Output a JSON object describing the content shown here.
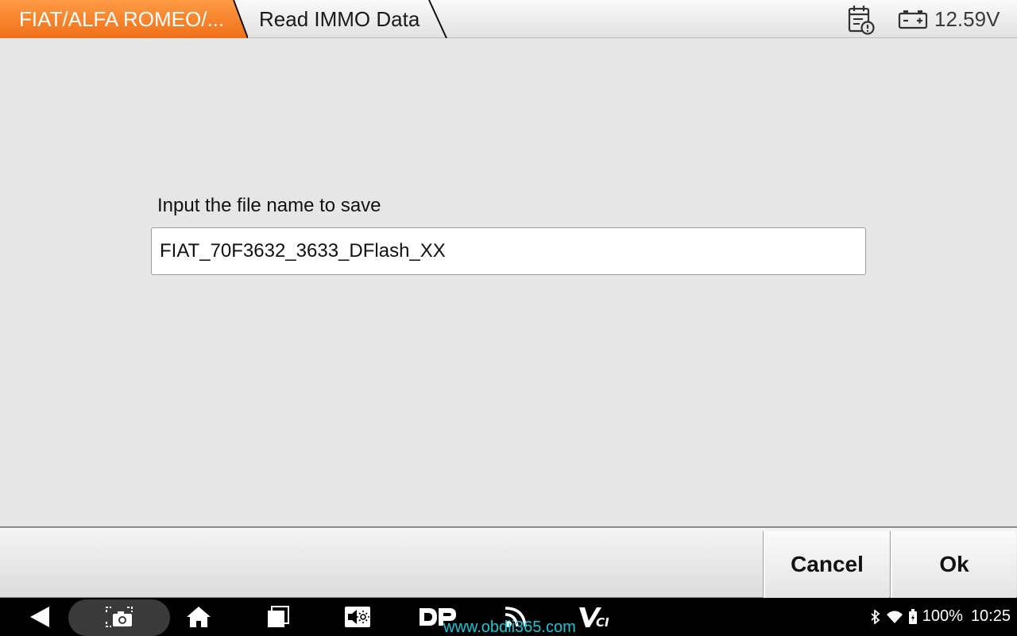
{
  "header": {
    "breadcrumb_1": "FIAT/ALFA ROMEO/...",
    "breadcrumb_2": "Read IMMO Data",
    "voltage": "12.59V",
    "accent_color": "#f47b20"
  },
  "dialog": {
    "prompt": "Input the file name to save",
    "filename_value": "FIAT_70F3632_3633_DFlash_XX"
  },
  "actions": {
    "cancel_label": "Cancel",
    "ok_label": "Ok"
  },
  "navbar": {
    "icons": [
      "back-icon",
      "screenshot-icon",
      "home-icon",
      "recents-icon",
      "volume-icon",
      "dp-icon",
      "signal-icon",
      "vci-icon"
    ],
    "watermark": "www.obdii365.com",
    "battery_percent": "100%",
    "time": "10:25"
  }
}
